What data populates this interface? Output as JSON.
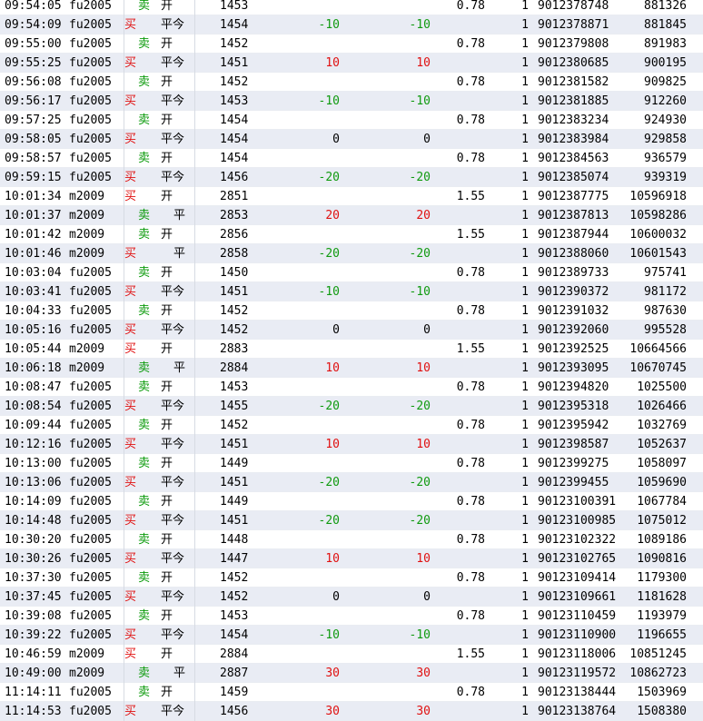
{
  "rows": [
    {
      "time": "09:54:05",
      "inst": "fu2005",
      "side": "卖",
      "side_type": "sell",
      "oc": "开",
      "oc_type": "kai",
      "price": "1453",
      "pnl": "",
      "pnl2": "",
      "fee": "0.78",
      "qty": "1",
      "order": "9012378748",
      "trade": "881326",
      "pnl_color": "green"
    },
    {
      "time": "09:54:09",
      "inst": "fu2005",
      "side": "买",
      "side_type": "buy",
      "oc": "平今",
      "oc_type": "pingjin",
      "price": "1454",
      "pnl": "-10",
      "pnl2": "-10",
      "fee": "",
      "qty": "1",
      "order": "9012378871",
      "trade": "881845",
      "pnl_color": "green"
    },
    {
      "time": "09:55:00",
      "inst": "fu2005",
      "side": "卖",
      "side_type": "sell",
      "oc": "开",
      "oc_type": "kai",
      "price": "1452",
      "pnl": "",
      "pnl2": "",
      "fee": "0.78",
      "qty": "1",
      "order": "9012379808",
      "trade": "891983",
      "pnl_color": "green"
    },
    {
      "time": "09:55:25",
      "inst": "fu2005",
      "side": "买",
      "side_type": "buy",
      "oc": "平今",
      "oc_type": "pingjin",
      "price": "1451",
      "pnl": "10",
      "pnl2": "10",
      "fee": "",
      "qty": "1",
      "order": "9012380685",
      "trade": "900195",
      "pnl_color": "red"
    },
    {
      "time": "09:56:08",
      "inst": "fu2005",
      "side": "卖",
      "side_type": "sell",
      "oc": "开",
      "oc_type": "kai",
      "price": "1452",
      "pnl": "",
      "pnl2": "",
      "fee": "0.78",
      "qty": "1",
      "order": "9012381582",
      "trade": "909825",
      "pnl_color": "green"
    },
    {
      "time": "09:56:17",
      "inst": "fu2005",
      "side": "买",
      "side_type": "buy",
      "oc": "平今",
      "oc_type": "pingjin",
      "price": "1453",
      "pnl": "-10",
      "pnl2": "-10",
      "fee": "",
      "qty": "1",
      "order": "9012381885",
      "trade": "912260",
      "pnl_color": "green"
    },
    {
      "time": "09:57:25",
      "inst": "fu2005",
      "side": "卖",
      "side_type": "sell",
      "oc": "开",
      "oc_type": "kai",
      "price": "1454",
      "pnl": "",
      "pnl2": "",
      "fee": "0.78",
      "qty": "1",
      "order": "9012383234",
      "trade": "924930",
      "pnl_color": "green"
    },
    {
      "time": "09:58:05",
      "inst": "fu2005",
      "side": "买",
      "side_type": "buy",
      "oc": "平今",
      "oc_type": "pingjin",
      "price": "1454",
      "pnl": "0",
      "pnl2": "0",
      "fee": "",
      "qty": "1",
      "order": "9012383984",
      "trade": "929858",
      "pnl_color": "black"
    },
    {
      "time": "09:58:57",
      "inst": "fu2005",
      "side": "卖",
      "side_type": "sell",
      "oc": "开",
      "oc_type": "kai",
      "price": "1454",
      "pnl": "",
      "pnl2": "",
      "fee": "0.78",
      "qty": "1",
      "order": "9012384563",
      "trade": "936579",
      "pnl_color": "green"
    },
    {
      "time": "09:59:15",
      "inst": "fu2005",
      "side": "买",
      "side_type": "buy",
      "oc": "平今",
      "oc_type": "pingjin",
      "price": "1456",
      "pnl": "-20",
      "pnl2": "-20",
      "fee": "",
      "qty": "1",
      "order": "9012385074",
      "trade": "939319",
      "pnl_color": "green"
    },
    {
      "time": "10:01:34",
      "inst": "m2009",
      "side": "买",
      "side_type": "buy",
      "oc": "开",
      "oc_type": "kai",
      "price": "2851",
      "pnl": "",
      "pnl2": "",
      "fee": "1.55",
      "qty": "1",
      "order": "9012387775",
      "trade": "10596918",
      "pnl_color": "green"
    },
    {
      "time": "10:01:37",
      "inst": "m2009",
      "side": "卖",
      "side_type": "sell",
      "oc": "平",
      "oc_type": "ping",
      "price": "2853",
      "pnl": "20",
      "pnl2": "20",
      "fee": "",
      "qty": "1",
      "order": "9012387813",
      "trade": "10598286",
      "pnl_color": "red"
    },
    {
      "time": "10:01:42",
      "inst": "m2009",
      "side": "卖",
      "side_type": "sell",
      "oc": "开",
      "oc_type": "kai",
      "price": "2856",
      "pnl": "",
      "pnl2": "",
      "fee": "1.55",
      "qty": "1",
      "order": "9012387944",
      "trade": "10600032",
      "pnl_color": "green"
    },
    {
      "time": "10:01:46",
      "inst": "m2009",
      "side": "买",
      "side_type": "buy",
      "oc": "平",
      "oc_type": "ping",
      "price": "2858",
      "pnl": "-20",
      "pnl2": "-20",
      "fee": "",
      "qty": "1",
      "order": "9012388060",
      "trade": "10601543",
      "pnl_color": "green"
    },
    {
      "time": "10:03:04",
      "inst": "fu2005",
      "side": "卖",
      "side_type": "sell",
      "oc": "开",
      "oc_type": "kai",
      "price": "1450",
      "pnl": "",
      "pnl2": "",
      "fee": "0.78",
      "qty": "1",
      "order": "9012389733",
      "trade": "975741",
      "pnl_color": "green"
    },
    {
      "time": "10:03:41",
      "inst": "fu2005",
      "side": "买",
      "side_type": "buy",
      "oc": "平今",
      "oc_type": "pingjin",
      "price": "1451",
      "pnl": "-10",
      "pnl2": "-10",
      "fee": "",
      "qty": "1",
      "order": "9012390372",
      "trade": "981172",
      "pnl_color": "green"
    },
    {
      "time": "10:04:33",
      "inst": "fu2005",
      "side": "卖",
      "side_type": "sell",
      "oc": "开",
      "oc_type": "kai",
      "price": "1452",
      "pnl": "",
      "pnl2": "",
      "fee": "0.78",
      "qty": "1",
      "order": "9012391032",
      "trade": "987630",
      "pnl_color": "green"
    },
    {
      "time": "10:05:16",
      "inst": "fu2005",
      "side": "买",
      "side_type": "buy",
      "oc": "平今",
      "oc_type": "pingjin",
      "price": "1452",
      "pnl": "0",
      "pnl2": "0",
      "fee": "",
      "qty": "1",
      "order": "9012392060",
      "trade": "995528",
      "pnl_color": "black"
    },
    {
      "time": "10:05:44",
      "inst": "m2009",
      "side": "买",
      "side_type": "buy",
      "oc": "开",
      "oc_type": "kai",
      "price": "2883",
      "pnl": "",
      "pnl2": "",
      "fee": "1.55",
      "qty": "1",
      "order": "9012392525",
      "trade": "10664566",
      "pnl_color": "green"
    },
    {
      "time": "10:06:18",
      "inst": "m2009",
      "side": "卖",
      "side_type": "sell",
      "oc": "平",
      "oc_type": "ping",
      "price": "2884",
      "pnl": "10",
      "pnl2": "10",
      "fee": "",
      "qty": "1",
      "order": "9012393095",
      "trade": "10670745",
      "pnl_color": "red"
    },
    {
      "time": "10:08:47",
      "inst": "fu2005",
      "side": "卖",
      "side_type": "sell",
      "oc": "开",
      "oc_type": "kai",
      "price": "1453",
      "pnl": "",
      "pnl2": "",
      "fee": "0.78",
      "qty": "1",
      "order": "9012394820",
      "trade": "1025500",
      "pnl_color": "green"
    },
    {
      "time": "10:08:54",
      "inst": "fu2005",
      "side": "买",
      "side_type": "buy",
      "oc": "平今",
      "oc_type": "pingjin",
      "price": "1455",
      "pnl": "-20",
      "pnl2": "-20",
      "fee": "",
      "qty": "1",
      "order": "9012395318",
      "trade": "1026466",
      "pnl_color": "green"
    },
    {
      "time": "10:09:44",
      "inst": "fu2005",
      "side": "卖",
      "side_type": "sell",
      "oc": "开",
      "oc_type": "kai",
      "price": "1452",
      "pnl": "",
      "pnl2": "",
      "fee": "0.78",
      "qty": "1",
      "order": "9012395942",
      "trade": "1032769",
      "pnl_color": "green"
    },
    {
      "time": "10:12:16",
      "inst": "fu2005",
      "side": "买",
      "side_type": "buy",
      "oc": "平今",
      "oc_type": "pingjin",
      "price": "1451",
      "pnl": "10",
      "pnl2": "10",
      "fee": "",
      "qty": "1",
      "order": "9012398587",
      "trade": "1052637",
      "pnl_color": "red"
    },
    {
      "time": "10:13:00",
      "inst": "fu2005",
      "side": "卖",
      "side_type": "sell",
      "oc": "开",
      "oc_type": "kai",
      "price": "1449",
      "pnl": "",
      "pnl2": "",
      "fee": "0.78",
      "qty": "1",
      "order": "9012399275",
      "trade": "1058097",
      "pnl_color": "green"
    },
    {
      "time": "10:13:06",
      "inst": "fu2005",
      "side": "买",
      "side_type": "buy",
      "oc": "平今",
      "oc_type": "pingjin",
      "price": "1451",
      "pnl": "-20",
      "pnl2": "-20",
      "fee": "",
      "qty": "1",
      "order": "9012399455",
      "trade": "1059690",
      "pnl_color": "green"
    },
    {
      "time": "10:14:09",
      "inst": "fu2005",
      "side": "卖",
      "side_type": "sell",
      "oc": "开",
      "oc_type": "kai",
      "price": "1449",
      "pnl": "",
      "pnl2": "",
      "fee": "0.78",
      "qty": "1",
      "order": "90123100391",
      "trade": "1067784",
      "pnl_color": "green"
    },
    {
      "time": "10:14:48",
      "inst": "fu2005",
      "side": "买",
      "side_type": "buy",
      "oc": "平今",
      "oc_type": "pingjin",
      "price": "1451",
      "pnl": "-20",
      "pnl2": "-20",
      "fee": "",
      "qty": "1",
      "order": "90123100985",
      "trade": "1075012",
      "pnl_color": "green"
    },
    {
      "time": "10:30:20",
      "inst": "fu2005",
      "side": "卖",
      "side_type": "sell",
      "oc": "开",
      "oc_type": "kai",
      "price": "1448",
      "pnl": "",
      "pnl2": "",
      "fee": "0.78",
      "qty": "1",
      "order": "90123102322",
      "trade": "1089186",
      "pnl_color": "green"
    },
    {
      "time": "10:30:26",
      "inst": "fu2005",
      "side": "买",
      "side_type": "buy",
      "oc": "平今",
      "oc_type": "pingjin",
      "price": "1447",
      "pnl": "10",
      "pnl2": "10",
      "fee": "",
      "qty": "1",
      "order": "90123102765",
      "trade": "1090816",
      "pnl_color": "red"
    },
    {
      "time": "10:37:30",
      "inst": "fu2005",
      "side": "卖",
      "side_type": "sell",
      "oc": "开",
      "oc_type": "kai",
      "price": "1452",
      "pnl": "",
      "pnl2": "",
      "fee": "0.78",
      "qty": "1",
      "order": "90123109414",
      "trade": "1179300",
      "pnl_color": "green"
    },
    {
      "time": "10:37:45",
      "inst": "fu2005",
      "side": "买",
      "side_type": "buy",
      "oc": "平今",
      "oc_type": "pingjin",
      "price": "1452",
      "pnl": "0",
      "pnl2": "0",
      "fee": "",
      "qty": "1",
      "order": "90123109661",
      "trade": "1181628",
      "pnl_color": "black"
    },
    {
      "time": "10:39:08",
      "inst": "fu2005",
      "side": "卖",
      "side_type": "sell",
      "oc": "开",
      "oc_type": "kai",
      "price": "1453",
      "pnl": "",
      "pnl2": "",
      "fee": "0.78",
      "qty": "1",
      "order": "90123110459",
      "trade": "1193979",
      "pnl_color": "green"
    },
    {
      "time": "10:39:22",
      "inst": "fu2005",
      "side": "买",
      "side_type": "buy",
      "oc": "平今",
      "oc_type": "pingjin",
      "price": "1454",
      "pnl": "-10",
      "pnl2": "-10",
      "fee": "",
      "qty": "1",
      "order": "90123110900",
      "trade": "1196655",
      "pnl_color": "green"
    },
    {
      "time": "10:46:59",
      "inst": "m2009",
      "side": "买",
      "side_type": "buy",
      "oc": "开",
      "oc_type": "kai",
      "price": "2884",
      "pnl": "",
      "pnl2": "",
      "fee": "1.55",
      "qty": "1",
      "order": "90123118006",
      "trade": "10851245",
      "pnl_color": "green"
    },
    {
      "time": "10:49:00",
      "inst": "m2009",
      "side": "卖",
      "side_type": "sell",
      "oc": "平",
      "oc_type": "ping",
      "price": "2887",
      "pnl": "30",
      "pnl2": "30",
      "fee": "",
      "qty": "1",
      "order": "90123119572",
      "trade": "10862723",
      "pnl_color": "red"
    },
    {
      "time": "11:14:11",
      "inst": "fu2005",
      "side": "卖",
      "side_type": "sell",
      "oc": "开",
      "oc_type": "kai",
      "price": "1459",
      "pnl": "",
      "pnl2": "",
      "fee": "0.78",
      "qty": "1",
      "order": "90123138444",
      "trade": "1503969",
      "pnl_color": "green"
    },
    {
      "time": "11:14:53",
      "inst": "fu2005",
      "side": "买",
      "side_type": "buy",
      "oc": "平今",
      "oc_type": "pingjin",
      "price": "1456",
      "pnl": "30",
      "pnl2": "30",
      "fee": "",
      "qty": "1",
      "order": "90123138764",
      "trade": "1508380",
      "pnl_color": "red"
    }
  ],
  "colors": {
    "buy": "#e01010",
    "sell": "#0a9a0a",
    "profit": "#e01010",
    "loss": "#109a10",
    "row_alt": "#e9ecf4"
  }
}
